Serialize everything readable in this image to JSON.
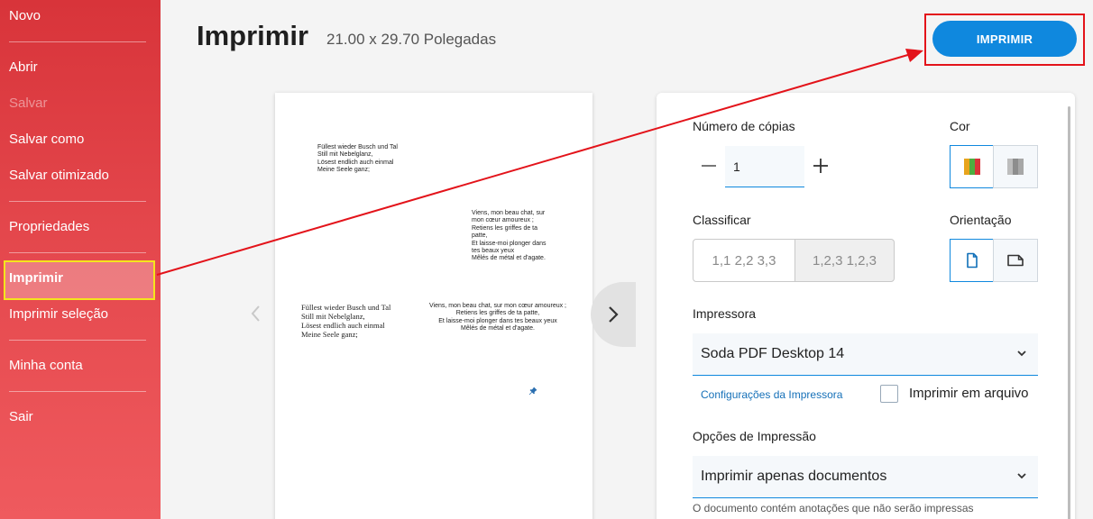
{
  "sidebar": {
    "items": [
      {
        "label": "Novo"
      },
      {
        "label": "Abrir"
      },
      {
        "label": "Salvar"
      },
      {
        "label": "Salvar como"
      },
      {
        "label": "Salvar otimizado"
      },
      {
        "label": "Propriedades"
      },
      {
        "label": "Imprimir"
      },
      {
        "label": "Imprimir seleção"
      },
      {
        "label": "Minha conta"
      },
      {
        "label": "Sair"
      }
    ]
  },
  "header": {
    "title": "Imprimir",
    "page_size": "21.00 x 29.70 Polegadas",
    "print_button": "IMPRIMIR"
  },
  "preview": {
    "block1": "Füllest wieder Busch und Tal\nStill mit Nebelglanz,\nLösest endlich auch einmal\nMeine Seele ganz;",
    "block2": "Viens, mon beau chat, sur\nmon cœur amoureux ;\nRetiens les griffes de ta\npatte,\nEt laisse-moi plonger dans\ntes beaux yeux\nMêlés de métal et d'agate.",
    "block3": "Füllest wieder Busch und Tal\nStill mit Nebelglanz,\nLösest endlich auch einmal\nMeine Seele ganz;",
    "block4": "Viens, mon beau chat, sur mon cœur amoureux ;\nRetiens les griffes de ta patte,\nEt laisse-moi plonger dans tes beaux yeux\nMêlés de métal et d'agate."
  },
  "settings": {
    "copies_label": "Número de cópias",
    "copies_value": "1",
    "color_label": "Cor",
    "collate_label": "Classificar",
    "collate_options": [
      "1,1 2,2 3,3",
      "1,2,3 1,2,3"
    ],
    "orientation_label": "Orientação",
    "printer_label": "Impressora",
    "printer_value": "Soda PDF Desktop 14",
    "printer_settings_link": "Configurações da Impressora",
    "print_to_file_label": "Imprimir em arquivo",
    "print_options_label": "Opções de Impressão",
    "print_options_value": "Imprimir apenas documentos",
    "annotation_note": "O documento contém anotações que não serão impressas"
  },
  "colors": {
    "sidebar_top": "#d8343a",
    "sidebar_bottom": "#ef5a5e",
    "accent_blue": "#0f88de",
    "highlight_red": "#e3131a",
    "highlight_yellow": "#f5e51c"
  }
}
